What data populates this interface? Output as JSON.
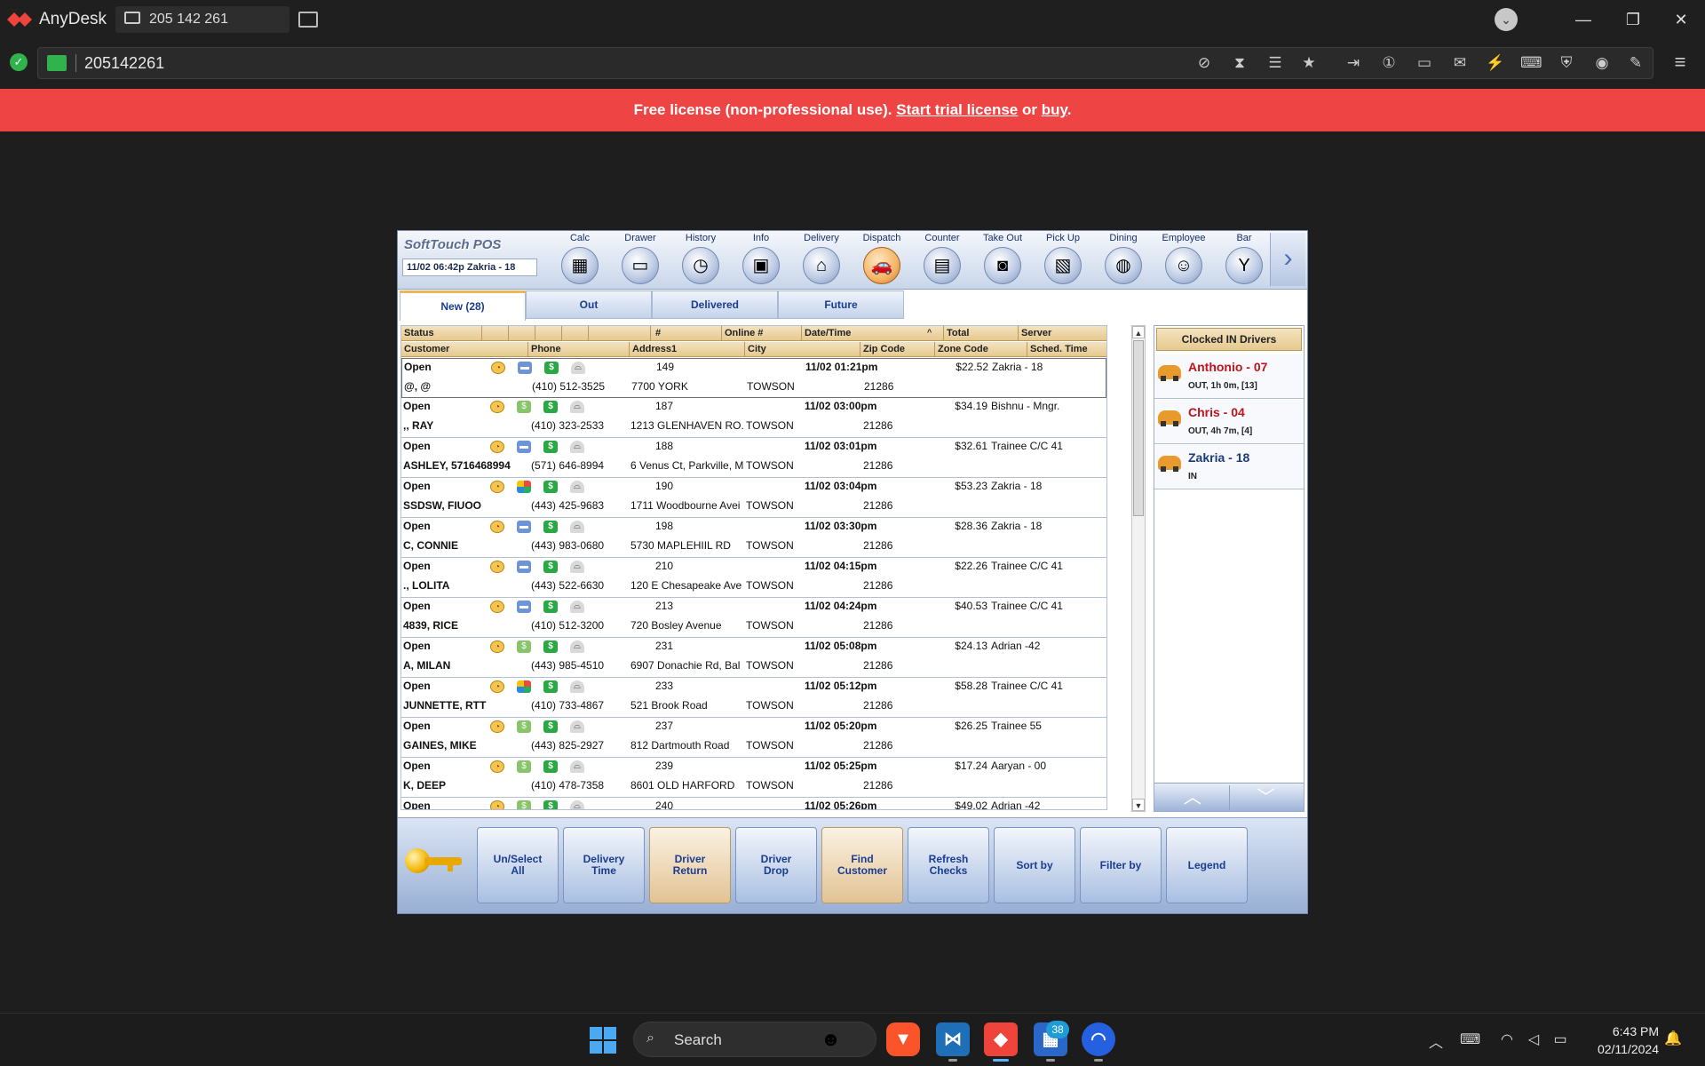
{
  "app": {
    "name": "AnyDesk",
    "session_tab": "205 142 261",
    "address": "205142261"
  },
  "banner": {
    "prefix": "Free license (non-professional use). ",
    "trial_link": "Start trial license",
    "middle": " or ",
    "buy_link": "buy",
    "suffix": "."
  },
  "pos": {
    "brand": "SoftTouch POS",
    "status_line": "11/02 06:42p  Zakria - 18",
    "nav": [
      {
        "label": "Calc",
        "icon": "calculator-icon",
        "glyph": "▦"
      },
      {
        "label": "Drawer",
        "icon": "cash-drawer-icon",
        "glyph": "▭"
      },
      {
        "label": "History",
        "icon": "clock-icon",
        "glyph": "◷"
      },
      {
        "label": "Info",
        "icon": "chalkboard-icon",
        "glyph": "▣"
      },
      {
        "label": "Delivery",
        "icon": "house-icon",
        "glyph": "⌂"
      },
      {
        "label": "Dispatch",
        "icon": "car-icon",
        "glyph": "🚗"
      },
      {
        "label": "Counter",
        "icon": "register-icon",
        "glyph": "▤"
      },
      {
        "label": "Take Out",
        "icon": "bag-icon",
        "glyph": "◙"
      },
      {
        "label": "Pick Up",
        "icon": "map-icon",
        "glyph": "▧"
      },
      {
        "label": "Dining",
        "icon": "plate-icon",
        "glyph": "◍"
      },
      {
        "label": "Employee",
        "icon": "people-icon",
        "glyph": "☺"
      },
      {
        "label": "Bar",
        "icon": "cocktail-icon",
        "glyph": "Y"
      }
    ],
    "active_nav": "Dispatch",
    "tabs": [
      {
        "label": "New (28)",
        "selected": true
      },
      {
        "label": "Out",
        "selected": false
      },
      {
        "label": "Delivered",
        "selected": false
      },
      {
        "label": "Future",
        "selected": false
      }
    ],
    "header1": {
      "status": "Status",
      "num": "#",
      "online": "Online #",
      "datetime": "Date/Time",
      "sort_mark": "^",
      "total": "Total",
      "server": "Server"
    },
    "header2": {
      "customer": "Customer",
      "phone": "Phone",
      "address": "Address1",
      "city": "City",
      "zip": "Zip Code",
      "zone": "Zone Code",
      "sched": "Sched. Time"
    },
    "orders": [
      {
        "status": "Open",
        "num": "149",
        "datetime": "11/02 01:21pm",
        "total": "$22.52",
        "server": "Zakria - 18",
        "customer": "@, @",
        "phone": "(410) 512-3525",
        "address": "7700 YORK",
        "city": "TOWSON",
        "zip": "21286",
        "pay": "card"
      },
      {
        "status": "Open",
        "num": "187",
        "datetime": "11/02 03:00pm",
        "total": "$34.19",
        "server": "Bishnu - Mngr.",
        "customer": ",, RAY",
        "phone": "(410) 323-2533",
        "address": "1213 GLENHAVEN RO.",
        "city": "TOWSON",
        "zip": "21286",
        "pay": "cash"
      },
      {
        "status": "Open",
        "num": "188",
        "datetime": "11/02 03:01pm",
        "total": "$32.61",
        "server": "Trainee C/C 41",
        "customer": "ASHLEY, 5716468994",
        "phone": "(571) 646-8994",
        "address": "6 Venus Ct, Parkville, M",
        "city": "TOWSON",
        "zip": "21286",
        "pay": "card"
      },
      {
        "status": "Open",
        "num": "190",
        "datetime": "11/02 03:04pm",
        "total": "$53.23",
        "server": "Zakria - 18",
        "customer": "SSDSW, FIUOO",
        "phone": "(443) 425-9683",
        "address": "1711 Woodbourne Avei",
        "city": "TOWSON",
        "zip": "21286",
        "pay": "multi"
      },
      {
        "status": "Open",
        "num": "198",
        "datetime": "11/02 03:30pm",
        "total": "$28.36",
        "server": "Zakria - 18",
        "customer": "C, CONNIE",
        "phone": "(443) 983-0680",
        "address": "5730 MAPLEHIIL RD",
        "city": "TOWSON",
        "zip": "21286",
        "pay": "card"
      },
      {
        "status": "Open",
        "num": "210",
        "datetime": "11/02 04:15pm",
        "total": "$22.26",
        "server": "Trainee C/C 41",
        "customer": "., LOLITA",
        "phone": "(443) 522-6630",
        "address": "120 E Chesapeake Ave",
        "city": "TOWSON",
        "zip": "21286",
        "pay": "card"
      },
      {
        "status": "Open",
        "num": "213",
        "datetime": "11/02 04:24pm",
        "total": "$40.53",
        "server": "Trainee C/C 41",
        "customer": "4839, RICE",
        "phone": "(410) 512-3200",
        "address": "720 Bosley Avenue",
        "city": "TOWSON",
        "zip": "21286",
        "pay": "card"
      },
      {
        "status": "Open",
        "num": "231",
        "datetime": "11/02 05:08pm",
        "total": "$24.13",
        "server": "Adrian -42",
        "customer": "A, MILAN",
        "phone": "(443) 985-4510",
        "address": "6907 Donachie Rd, Bal",
        "city": "TOWSON",
        "zip": "21286",
        "pay": "cash"
      },
      {
        "status": "Open",
        "num": "233",
        "datetime": "11/02 05:12pm",
        "total": "$58.28",
        "server": "Trainee C/C 41",
        "customer": "JUNNETTE, RTT",
        "phone": "(410) 733-4867",
        "address": "521 Brook Road",
        "city": "TOWSON",
        "zip": "21286",
        "pay": "multi"
      },
      {
        "status": "Open",
        "num": "237",
        "datetime": "11/02 05:20pm",
        "total": "$26.25",
        "server": "Trainee 55",
        "customer": "GAINES, MIKE",
        "phone": "(443) 825-2927",
        "address": "812 Dartmouth Road",
        "city": "TOWSON",
        "zip": "21286",
        "pay": "cash"
      },
      {
        "status": "Open",
        "num": "239",
        "datetime": "11/02 05:25pm",
        "total": "$17.24",
        "server": "Aaryan - 00",
        "customer": "K, DEEP",
        "phone": "(410) 478-7358",
        "address": "8601 OLD HARFORD",
        "city": "TOWSON",
        "zip": "21286",
        "pay": "cash"
      },
      {
        "status": "Open",
        "num": "240",
        "datetime": "11/02 05:26pm",
        "total": "$49.02",
        "server": "Adrian -42",
        "customer": "",
        "phone": "",
        "address": "",
        "city": "",
        "zip": "",
        "pay": "cash"
      }
    ],
    "drivers_title": "Clocked IN Drivers",
    "drivers": [
      {
        "name": "Anthonio - 07",
        "status": "OUT, 1h 0m, [13]",
        "color": "#c0141c"
      },
      {
        "name": "Chris - 04",
        "status": "OUT, 4h 7m, [4]",
        "color": "#c0141c"
      },
      {
        "name": "Zakria - 18",
        "status": "IN",
        "color": "#1b3c7a"
      }
    ],
    "actions": [
      {
        "label": "Un/Select\nAll",
        "warm": false
      },
      {
        "label": "Delivery\nTime",
        "warm": false
      },
      {
        "label": "Driver\nReturn",
        "warm": true
      },
      {
        "label": "Driver\nDrop",
        "warm": false
      },
      {
        "label": "Find\nCustomer",
        "warm": true
      },
      {
        "label": "Refresh\nChecks",
        "warm": false
      },
      {
        "label": "Sort by",
        "warm": false
      },
      {
        "label": "Filter by",
        "warm": false
      },
      {
        "label": "Legend",
        "warm": false
      }
    ]
  },
  "taskbar": {
    "search_text": "Search",
    "badge": "38",
    "time": "6:43 PM",
    "date": "02/11/2024"
  },
  "colors": {
    "banner": "#ef4444",
    "pos_header": "#e6c98f",
    "driver_out": "#c0141c",
    "driver_in": "#1b3c7a"
  }
}
